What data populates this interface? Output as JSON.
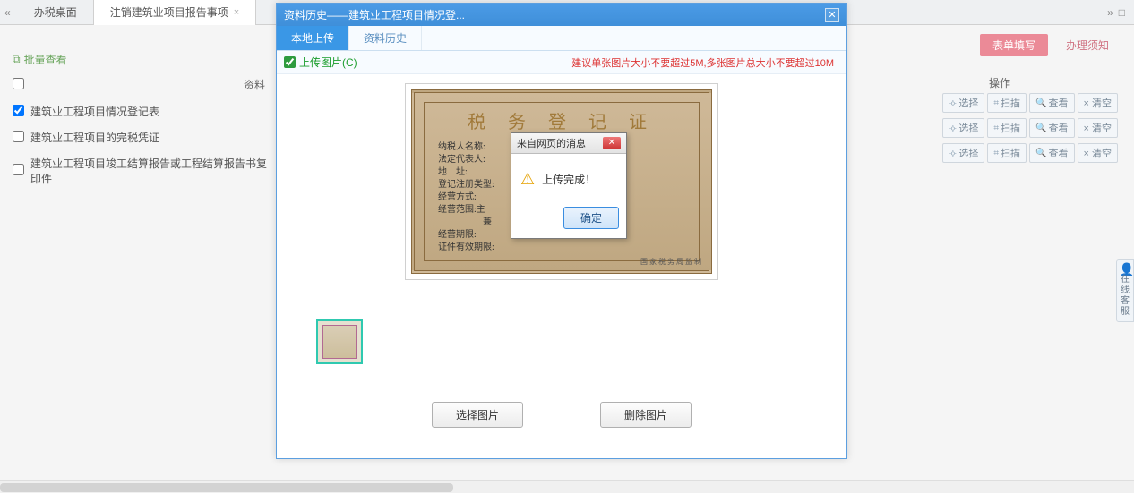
{
  "top_tabs": {
    "chevron": "«",
    "tab1": "办税桌面",
    "tab2": "注销建筑业项目报告事项",
    "right_icon1": "»",
    "right_icon2": "□"
  },
  "right_pills": {
    "active": "表单填写",
    "inactive": "办理须知"
  },
  "batch": {
    "label": "批量查看"
  },
  "list": {
    "header_name": "资料",
    "rows": [
      {
        "checked": true,
        "label": "建筑业工程项目情况登记表"
      },
      {
        "checked": false,
        "label": "建筑业工程项目的完税凭证"
      },
      {
        "checked": false,
        "label": "建筑业工程项目竣工结算报告或工程结算报告书复印件"
      }
    ]
  },
  "ops": {
    "header": "操作",
    "btn_select": "选择",
    "btn_scan": "扫描",
    "btn_view": "查看",
    "btn_clear": "× 清空"
  },
  "modal": {
    "title": "资料历史——建筑业工程项目情况登...",
    "tab_local": "本地上传",
    "tab_history": "资料历史",
    "upload_link": "上传图片(C)",
    "hint": "建议单张图片大小不要超过5M,多张图片总大小不要超过10M",
    "cert_title": "税 务 登 记 证",
    "cert_lines": "纳税人名称:\n法定代表人:\n地    址:\n登记注册类型:\n经营方式:\n经营范围:主\n                    兼\n经营期限:\n证件有效期限:",
    "cert_stamp": "国家税务局监制",
    "btn_choose": "选择图片",
    "btn_delete": "删除图片"
  },
  "alert": {
    "title": "来自网页的消息",
    "message": "上传完成！",
    "ok": "确定"
  },
  "float_help": {
    "label": "在线客服"
  }
}
